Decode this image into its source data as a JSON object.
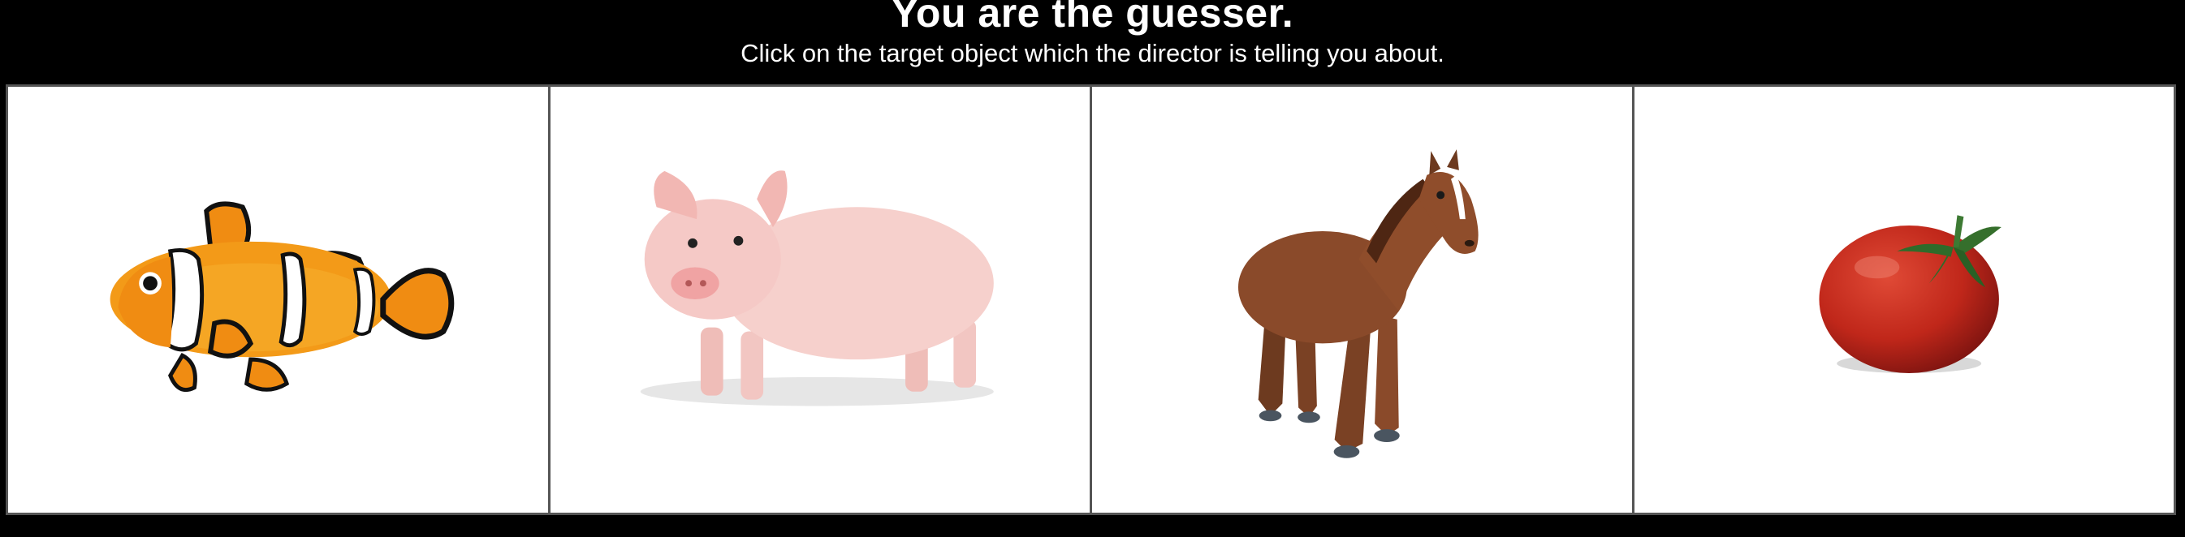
{
  "header": {
    "title": "You are the guesser.",
    "subtitle": "Click on the target object which the director is telling you about."
  },
  "objects": [
    {
      "icon": "clownfish-icon"
    },
    {
      "icon": "pig-icon"
    },
    {
      "icon": "horse-icon"
    },
    {
      "icon": "tomato-icon"
    }
  ],
  "colors": {
    "background": "#000000",
    "cell": "#ffffff",
    "clownfish_orange": "#f08c12",
    "pig_pink": "#f5c9c6",
    "horse_brown": "#8a4a2a",
    "tomato_red": "#c0271a"
  }
}
